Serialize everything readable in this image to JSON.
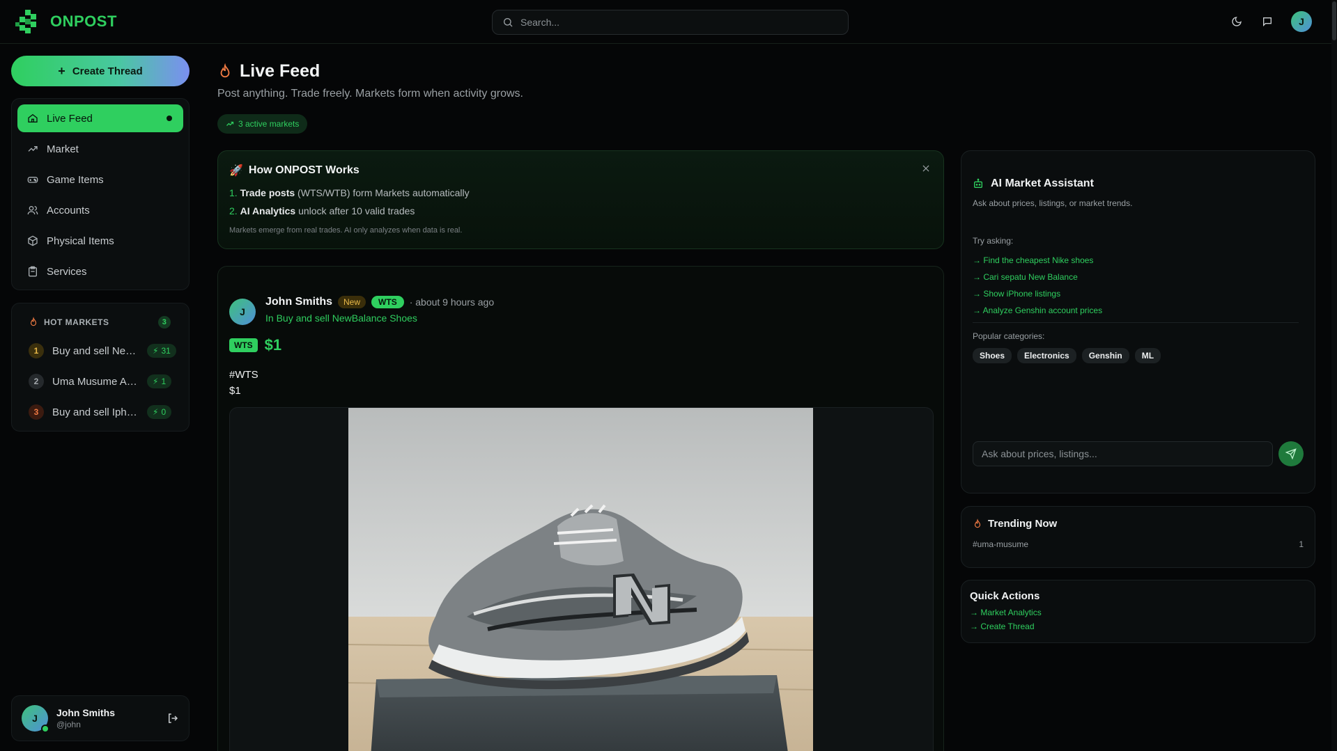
{
  "header": {
    "brand": "ONPOST",
    "search_placeholder": "Search...",
    "avatar_initial": "J"
  },
  "sidebar": {
    "create_label": "Create Thread",
    "nav": [
      {
        "label": "Live Feed",
        "icon": "home-icon",
        "active": true
      },
      {
        "label": "Market",
        "icon": "trending-icon"
      },
      {
        "label": "Game Items",
        "icon": "gamepad-icon"
      },
      {
        "label": "Accounts",
        "icon": "users-icon"
      },
      {
        "label": "Physical Items",
        "icon": "package-icon"
      },
      {
        "label": "Services",
        "icon": "clipboard-icon"
      }
    ],
    "hot_markets": {
      "title": "HOT MARKETS",
      "count": "3",
      "items": [
        {
          "rank": "1",
          "name": "Buy and sell New...",
          "count": "31"
        },
        {
          "rank": "2",
          "name": "Uma Musume Acc...",
          "count": "1"
        },
        {
          "rank": "3",
          "name": "Buy and sell Iphone",
          "count": "0"
        }
      ]
    },
    "user": {
      "initial": "J",
      "name": "John Smiths",
      "handle": "@john"
    }
  },
  "main": {
    "title": "Live Feed",
    "subtitle": "Post anything. Trade freely. Markets form when activity grows.",
    "active_markets": "3 active markets",
    "how": {
      "title": "How ONPOST Works",
      "step1_num": "1.",
      "step1_bold": "Trade posts",
      "step1_rest": " (WTS/WTB) form Markets automatically",
      "step2_num": "2.",
      "step2_bold": "AI Analytics",
      "step2_rest": " unlock after 10 valid trades",
      "note": "Markets emerge from real trades. AI only analyzes when data is real."
    },
    "post": {
      "initial": "J",
      "author": "John Smiths",
      "badge_new": "New",
      "badge_type": "WTS",
      "time": "· about 9 hours ago",
      "market": "In Buy and sell NewBalance Shoes",
      "price_tag": "WTS",
      "price": "$1",
      "body_line1": "#WTS",
      "body_line2": "$1"
    }
  },
  "right": {
    "ai": {
      "title": "AI Market Assistant",
      "subtitle": "Ask about prices, listings, or market trends.",
      "try_label": "Try asking:",
      "suggestions": [
        "→ Find the cheapest Nike shoes",
        "→ Cari sepatu New Balance",
        "→ Show iPhone listings",
        "→ Analyze Genshin account prices"
      ],
      "popular_label": "Popular categories:",
      "categories": [
        "Shoes",
        "Electronics",
        "Genshin",
        "ML"
      ],
      "input_placeholder": "Ask about prices, listings..."
    },
    "trending": {
      "title": "Trending Now",
      "tag": "#uma-musume",
      "count": "1"
    },
    "quick_actions": {
      "title": "Quick Actions",
      "links": [
        "→ Market Analytics",
        "→ Create Thread"
      ]
    }
  },
  "colors": {
    "accent": "#2fcf5f",
    "background": "#050607",
    "card": "#0b0e0f"
  }
}
